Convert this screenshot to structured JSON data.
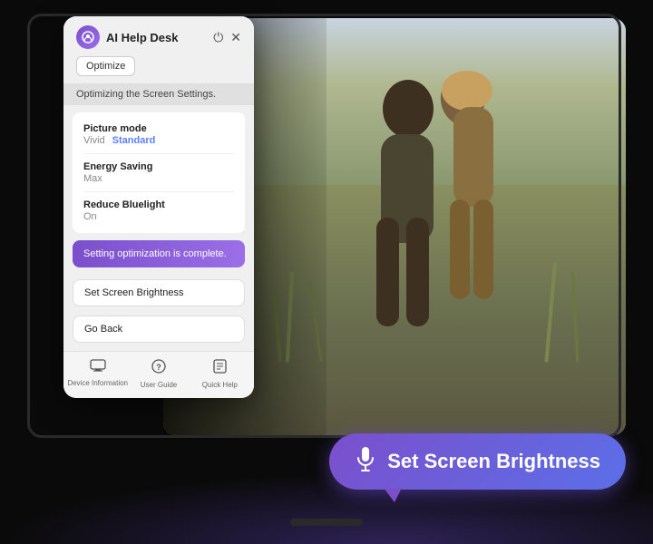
{
  "app": {
    "title": "AI Help Desk",
    "optimize_btn": "Optimize",
    "status_text": "Optimizing the Screen Settings.",
    "ai_icon": "🤖"
  },
  "settings": {
    "items": [
      {
        "name": "Picture mode",
        "values": [
          {
            "label": "Vivid",
            "active": false
          },
          {
            "label": "Standard",
            "active": true
          }
        ]
      },
      {
        "name": "Energy Saving",
        "values": [
          {
            "label": "Max",
            "active": false
          }
        ]
      },
      {
        "name": "Reduce Bluelight",
        "values": [
          {
            "label": "On",
            "active": false
          }
        ]
      }
    ]
  },
  "success_message": "Setting optimization is complete.",
  "actions": {
    "set_brightness": "Set Screen Brightness",
    "go_back": "Go Back"
  },
  "footer": {
    "items": [
      {
        "icon": "▭",
        "label": "Device Information"
      },
      {
        "icon": "?",
        "label": "User Guide"
      },
      {
        "icon": "▣",
        "label": "Quick Help"
      }
    ]
  },
  "speech_bubble": {
    "text": "Set Screen Brightness",
    "mic_icon": "🎤"
  },
  "colors": {
    "accent": "#7b4fcc",
    "active_text": "#5b7fff",
    "success_bg_start": "#7b4fcc",
    "success_bg_end": "#9b6fe8"
  }
}
